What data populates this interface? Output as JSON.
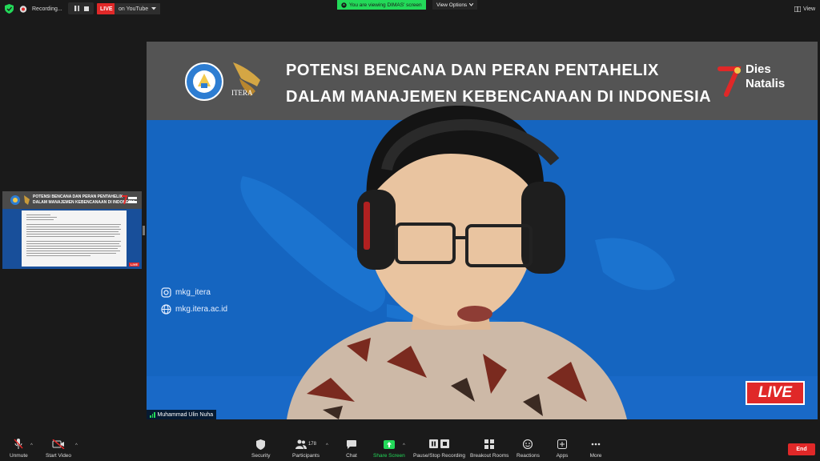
{
  "topbar": {
    "recording_label": "Recording...",
    "live_label": "LIVE",
    "stream_target": "on YouTube",
    "viewing_banner": "You are viewing DIMAS' screen",
    "view_options": "View Options",
    "view_button": "View"
  },
  "thumbnail": {
    "title_line1": "POTENSI BENCANA DAN PERAN PENTAHELIX",
    "title_line2": "DALAM MANAJEMEN KEBENCANAAN DI INDONESIA",
    "live": "LIVE"
  },
  "slide": {
    "title_line1": "POTENSI BENCANA DAN PERAN PENTAHELIX",
    "title_line2": "DALAM MANAJEMEN KEBENCANAAN DI INDONESIA",
    "itera_label": "ITERA",
    "dies_line1": "Dies",
    "dies_line2": "Natalis",
    "instagram": "mkg_itera",
    "website": "mkg.itera.ac.id",
    "live_badge": "LIVE"
  },
  "participant": {
    "name": "Muhammad Ulin Nuha"
  },
  "toolbar": {
    "unmute": "Unmute",
    "start_video": "Start Video",
    "security": "Security",
    "participants": "Participants",
    "participants_count": "178",
    "chat": "Chat",
    "share_screen": "Share Screen",
    "pause_recording": "Pause/Stop Recording",
    "breakout_rooms": "Breakout Rooms",
    "reactions": "Reactions",
    "apps": "Apps",
    "more": "More",
    "end": "End"
  },
  "colors": {
    "accent_green": "#23d959",
    "live_red": "#e02828",
    "slide_blue": "#1565c0",
    "banner_gray": "#545454"
  }
}
